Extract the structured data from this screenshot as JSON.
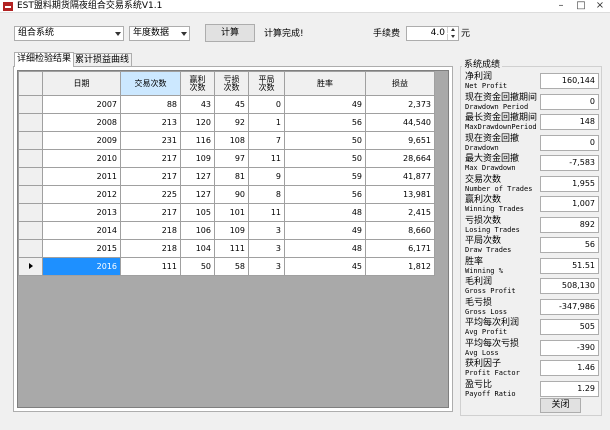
{
  "window": {
    "title": "EST盟料期货隔夜组合交易系统V1.1"
  },
  "toolbar": {
    "combo_system": "组合系统",
    "combo_type": "年度数据",
    "calc_button": "计算",
    "status": "计算完成!",
    "fee_label": "手续费",
    "fee_value": "4.0",
    "fee_unit": "元"
  },
  "tabs": [
    "详细检验结果",
    "累计损益曲线"
  ],
  "grid": {
    "columns": [
      "日期",
      "交易次数",
      "赢利\n次数",
      "亏损\n次数",
      "平局\n次数",
      "胜率",
      "损益"
    ],
    "rows": [
      [
        "2007",
        "88",
        "43",
        "45",
        "0",
        "49",
        "2,373"
      ],
      [
        "2008",
        "213",
        "120",
        "92",
        "1",
        "56",
        "44,540"
      ],
      [
        "2009",
        "231",
        "116",
        "108",
        "7",
        "50",
        "9,651"
      ],
      [
        "2010",
        "217",
        "109",
        "97",
        "11",
        "50",
        "28,664"
      ],
      [
        "2011",
        "217",
        "127",
        "81",
        "9",
        "59",
        "41,877"
      ],
      [
        "2012",
        "225",
        "127",
        "90",
        "8",
        "56",
        "13,981"
      ],
      [
        "2013",
        "217",
        "105",
        "101",
        "11",
        "48",
        "2,415"
      ],
      [
        "2014",
        "218",
        "106",
        "109",
        "3",
        "49",
        "8,660"
      ],
      [
        "2015",
        "218",
        "104",
        "111",
        "3",
        "48",
        "6,171"
      ],
      [
        "2016",
        "111",
        "50",
        "58",
        "3",
        "45",
        "1,812"
      ]
    ],
    "selected_row": 9
  },
  "stats_group_title": "系统成绩",
  "stats": [
    {
      "cn": "净利润",
      "en": "Net Profit",
      "value": "160,144"
    },
    {
      "cn": "现在资金回撤期间",
      "en": "Drawdown Period",
      "value": "0"
    },
    {
      "cn": "最长资金回撤期间",
      "en": "MaxDrawdownPeriod",
      "value": "148"
    },
    {
      "cn": "现在资金回撤",
      "en": "Drawdown",
      "value": "0"
    },
    {
      "cn": "最大资金回撤",
      "en": "Max Drawdown",
      "value": "-7,583"
    },
    {
      "cn": "交易次数",
      "en": "Number of Trades",
      "value": "1,955"
    },
    {
      "cn": "赢利次数",
      "en": "Winning Trades",
      "value": "1,007"
    },
    {
      "cn": "亏损次数",
      "en": "Losing Trades",
      "value": "892"
    },
    {
      "cn": "平局次数",
      "en": "Draw Trades",
      "value": "56"
    },
    {
      "cn": "胜率",
      "en": "Winning %",
      "value": "51.51"
    },
    {
      "cn": "毛利润",
      "en": "Gross Profit",
      "value": "508,130"
    },
    {
      "cn": "毛亏损",
      "en": "Gross Loss",
      "value": "-347,986"
    },
    {
      "cn": "平均每次利润",
      "en": "Avg Profit",
      "value": "505"
    },
    {
      "cn": "平均每次亏损",
      "en": "Avg Loss",
      "value": "-390"
    },
    {
      "cn": "获利因子",
      "en": "Profit Factor",
      "value": "1.46"
    },
    {
      "cn": "盈亏比",
      "en": "Payoff Ratio",
      "value": "1.29"
    }
  ],
  "close_button": "关闭"
}
